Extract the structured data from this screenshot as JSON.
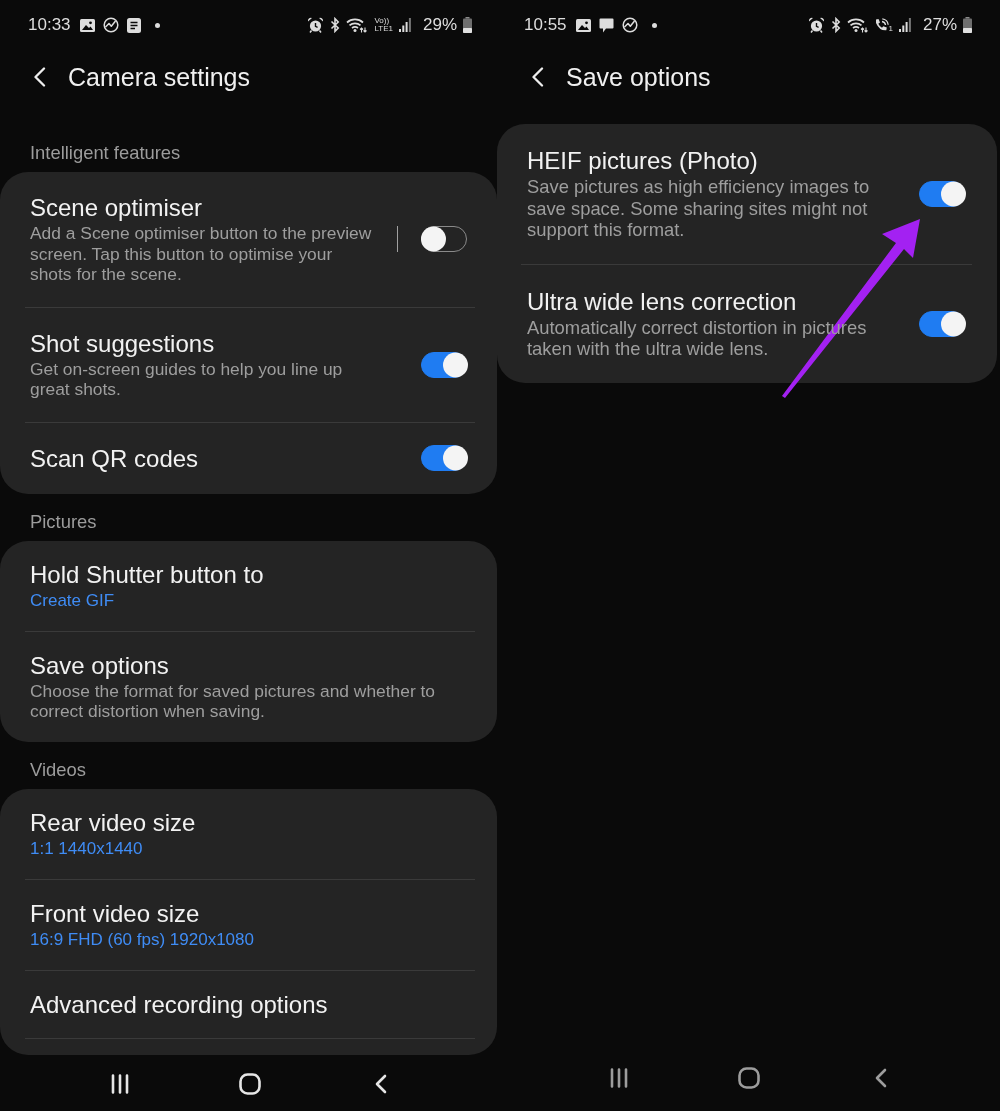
{
  "camera_settings_screen": {
    "status_bar": {
      "time": "10:33",
      "network_top": "Vo))",
      "network_bottom": "LTE1",
      "battery": "29%"
    },
    "header": {
      "title": "Camera settings"
    },
    "sections": [
      {
        "title": "Intelligent features",
        "items": [
          {
            "kind": "splitswitch",
            "title": "Scene optimiser",
            "description": "Add a Scene optimiser button to the preview screen. Tap this button to optimise your shots for the scene.",
            "on": false
          },
          {
            "kind": "switch",
            "title": "Shot suggestions",
            "description": "Get on-screen guides to help you line up great shots.",
            "on": true
          },
          {
            "kind": "switch",
            "title": "Scan QR codes",
            "on": true
          }
        ]
      },
      {
        "title": "Pictures",
        "items": [
          {
            "kind": "value",
            "title": "Hold Shutter button to",
            "value": "Create GIF"
          },
          {
            "kind": "text",
            "title": "Save options",
            "description": "Choose the format for saved pictures and whether to correct distortion when saving."
          }
        ]
      },
      {
        "title": "Videos",
        "continues": true,
        "items": [
          {
            "kind": "value",
            "title": "Rear video size",
            "value": "1:1 1440x1440"
          },
          {
            "kind": "value",
            "title": "Front video size",
            "value": "16:9 FHD (60 fps) 1920x1080"
          },
          {
            "kind": "text",
            "title": "Advanced recording options"
          }
        ]
      }
    ]
  },
  "save_options_screen": {
    "status_bar": {
      "time": "10:55",
      "call_sim": "1",
      "battery": "27%"
    },
    "header": {
      "title": "Save options"
    },
    "sections": [
      {
        "items": [
          {
            "kind": "switch",
            "title": "HEIF pictures (Photo)",
            "description": "Save pictures as high efficiency images to save space. Some sharing sites might not support this format.",
            "on": true
          },
          {
            "kind": "switch",
            "title": "Ultra wide lens correction",
            "description": "Automatically correct distortion in pictures taken with the ultra wide lens.",
            "on": true
          }
        ]
      }
    ]
  }
}
